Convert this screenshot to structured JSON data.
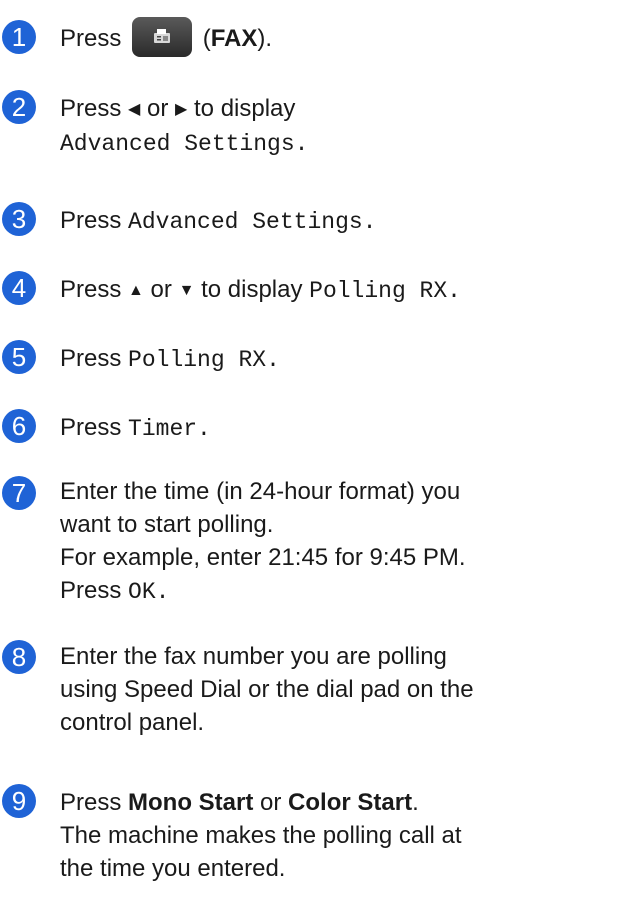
{
  "steps": [
    {
      "num": "1",
      "t1": "Press",
      "t2": "(",
      "t3": "FAX",
      "t4": ")."
    },
    {
      "num": "2",
      "t1": "Press",
      "left": "◀",
      "t2": "or",
      "right": "▶",
      "t3": "to display",
      "mono": "Advanced Settings",
      "end": "."
    },
    {
      "num": "3",
      "t1": "Press",
      "mono": "Advanced Settings",
      "end": "."
    },
    {
      "num": "4",
      "t1": "Press",
      "up": "▲",
      "t2": "or",
      "down": "▼",
      "t3": "to display",
      "mono": "Polling RX",
      "end": "."
    },
    {
      "num": "5",
      "t1": "Press",
      "mono": "Polling RX",
      "end": "."
    },
    {
      "num": "6",
      "t1": "Press",
      "mono": "Timer",
      "end": "."
    },
    {
      "num": "7",
      "l1": "Enter the time (in 24-hour format) you",
      "l2": "want to start polling.",
      "l3": "For example, enter 21:45 for 9:45 PM.",
      "l4": "Press",
      "mono": "OK",
      "end": "."
    },
    {
      "num": "8",
      "l1": "Enter the fax number you are polling",
      "l2": "using Speed Dial or the dial pad on the",
      "l3": "control panel."
    },
    {
      "num": "9",
      "t1": "Press",
      "b1": "Mono Start",
      "t2": "or",
      "b2": "Color Start",
      "end": ".",
      "l2": "The machine makes the polling call at",
      "l3": "the time you entered."
    }
  ],
  "icons": {
    "fax_button": "fax-icon",
    "arrows": [
      "left-arrow-icon",
      "right-arrow-icon",
      "up-arrow-icon",
      "down-arrow-icon"
    ]
  },
  "colors": {
    "step_number_bg": "#1f63d6",
    "button_bg": "#3a3a3a"
  }
}
